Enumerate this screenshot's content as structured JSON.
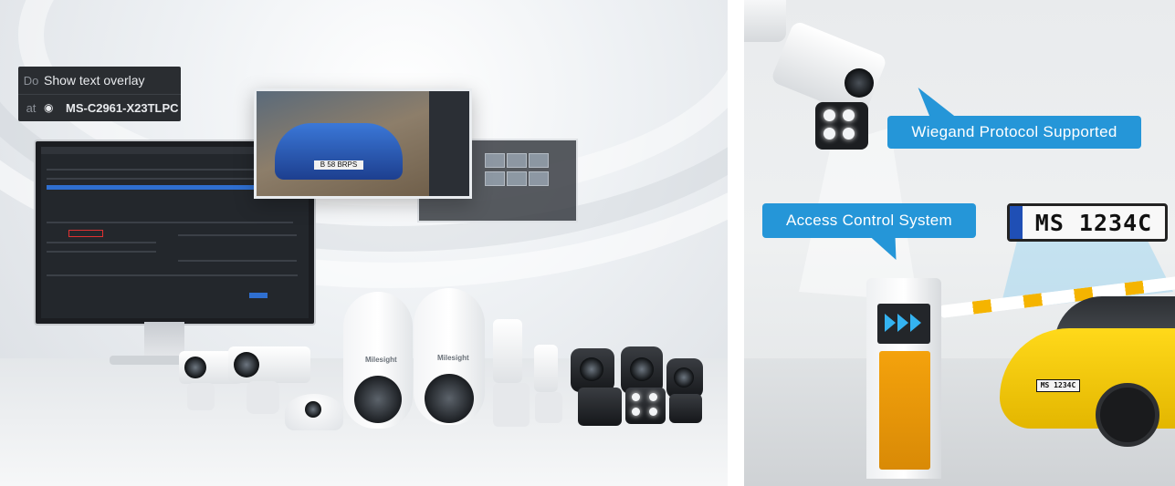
{
  "overlay_panel": {
    "row1_key": "Do",
    "row1_value": "Show text overlay",
    "row2_key": "at",
    "row2_value": "MS-C2961-X23TLPC"
  },
  "photo_plate": "B 58 BRPS",
  "camera_brand": "Milesight",
  "right_panel": {
    "bubble_wiegand": "Wiegand Protocol Supported",
    "bubble_access": "Access Control System",
    "license_plate": "MS 1234C",
    "car_plate": "MS 1234C"
  },
  "colors": {
    "bubble_blue": "#2596d8",
    "barrier_orange": "#f4a20c",
    "car_yellow": "#ffd91a",
    "ui_dark": "#2a2d31"
  }
}
